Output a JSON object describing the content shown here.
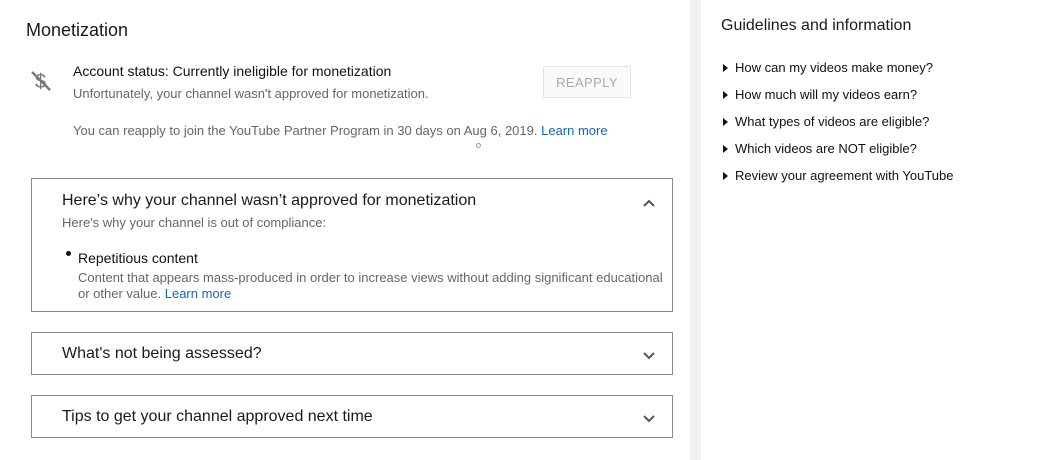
{
  "main": {
    "title": "Monetization",
    "status_icon": "no-money-icon",
    "status_line": "Account status: Currently ineligible for monetization",
    "status_sub": "Unfortunately, your channel wasn't approved for monetization.",
    "reapply_label": "REAPPLY",
    "reapply_note": "You can reapply to join the YouTube Partner Program in 30 days on Aug 6, 2019.",
    "reapply_link": "Learn more"
  },
  "panels": [
    {
      "title": "Here’s why your channel wasn’t approved for monetization",
      "subtitle": "Here's why your channel is out of compliance:",
      "expanded": true,
      "reason_title": "Repetitious content",
      "reason_desc": "Content that appears mass-produced in order to increase views without adding significant educational or other value.",
      "reason_link": "Learn more"
    },
    {
      "title": "What's not being assessed?",
      "expanded": false
    },
    {
      "title": "Tips to get your channel approved next time",
      "expanded": false
    }
  ],
  "sidebar": {
    "title": "Guidelines and information",
    "items": [
      {
        "label": "How can my videos make money?"
      },
      {
        "label": "How much will my videos earn?"
      },
      {
        "label": "What types of videos are eligible?"
      },
      {
        "label": "Which videos are NOT eligible?"
      },
      {
        "label": "Review your agreement with YouTube"
      }
    ]
  },
  "colors": {
    "link": "#1565c0",
    "border": "#8a8a8a",
    "muted": "#666666"
  }
}
